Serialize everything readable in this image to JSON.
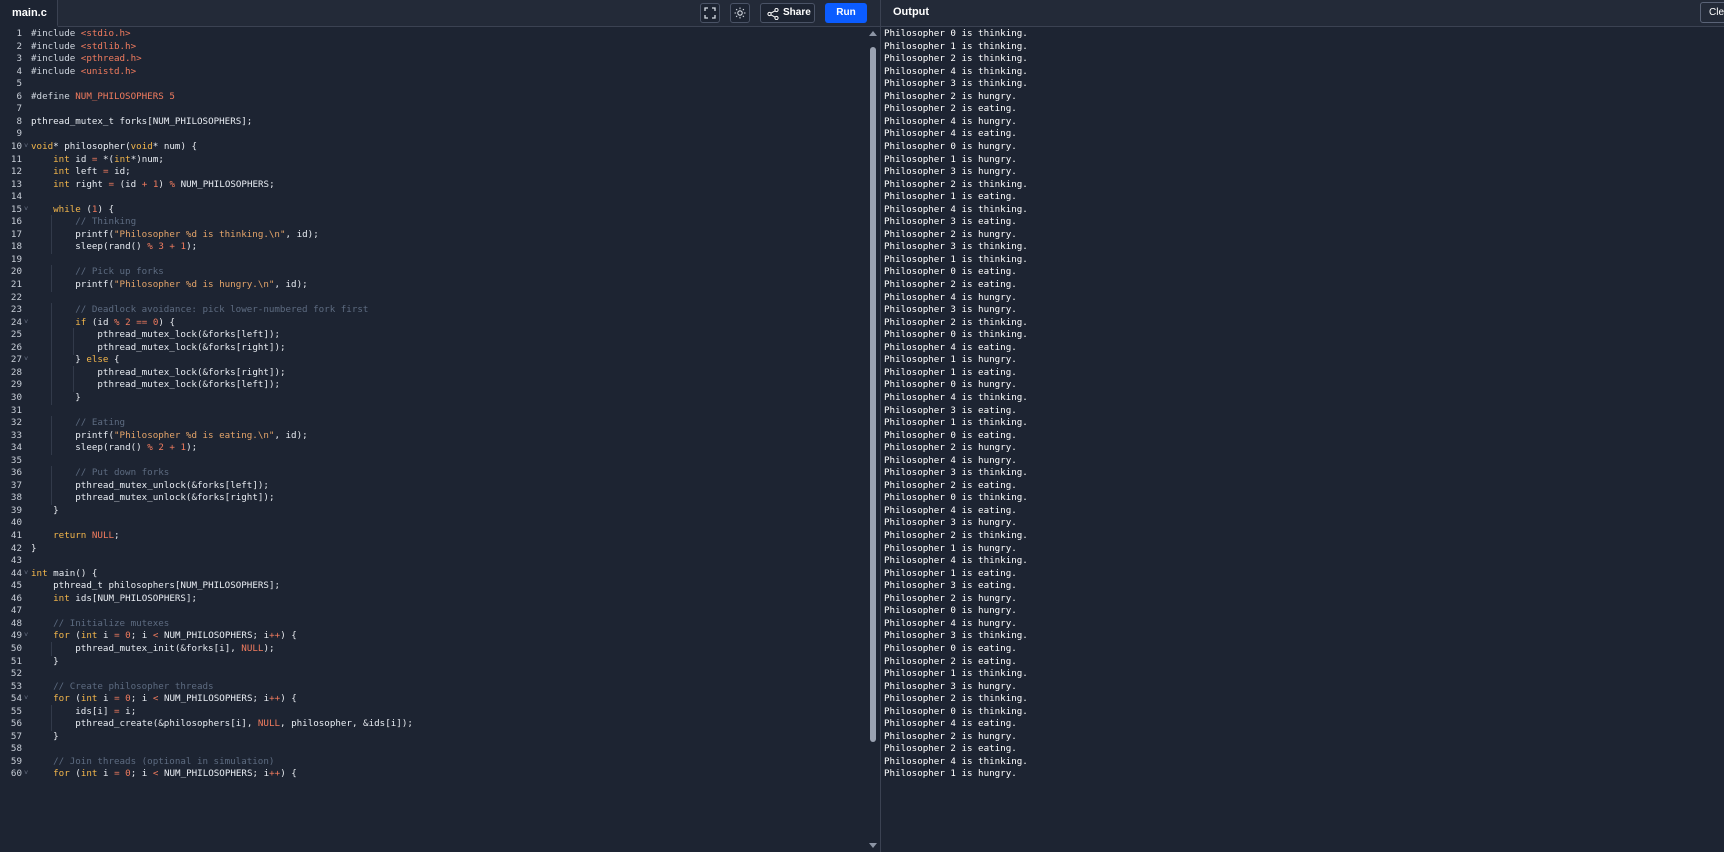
{
  "editor": {
    "file_tab": "main.c",
    "share_label": "Share",
    "run_label": "Run",
    "fullscreen_icon": "fullscreen-icon",
    "theme_icon": "sun-icon",
    "share_icon": "share-icon"
  },
  "output": {
    "title": "Output",
    "clear_label": "Clear"
  },
  "code_lines": [
    "#include <stdio.h>",
    "#include <stdlib.h>",
    "#include <pthread.h>",
    "#include <unistd.h>",
    "",
    "#define NUM_PHILOSOPHERS 5",
    "",
    "pthread_mutex_t forks[NUM_PHILOSOPHERS];",
    "",
    "void* philosopher(void* num) {",
    "    int id = *(int*)num;",
    "    int left = id;",
    "    int right = (id + 1) % NUM_PHILOSOPHERS;",
    "",
    "    while (1) {",
    "        // Thinking",
    "        printf(\"Philosopher %d is thinking.\\n\", id);",
    "        sleep(rand() % 3 + 1);",
    "",
    "        // Pick up forks",
    "        printf(\"Philosopher %d is hungry.\\n\", id);",
    "",
    "        // Deadlock avoidance: pick lower-numbered fork first",
    "        if (id % 2 == 0) {",
    "            pthread_mutex_lock(&forks[left]);",
    "            pthread_mutex_lock(&forks[right]);",
    "        } else {",
    "            pthread_mutex_lock(&forks[right]);",
    "            pthread_mutex_lock(&forks[left]);",
    "        }",
    "",
    "        // Eating",
    "        printf(\"Philosopher %d is eating.\\n\", id);",
    "        sleep(rand() % 2 + 1);",
    "",
    "        // Put down forks",
    "        pthread_mutex_unlock(&forks[left]);",
    "        pthread_mutex_unlock(&forks[right]);",
    "    }",
    "",
    "    return NULL;",
    "}",
    "",
    "int main() {",
    "    pthread_t philosophers[NUM_PHILOSOPHERS];",
    "    int ids[NUM_PHILOSOPHERS];",
    "",
    "    // Initialize mutexes",
    "    for (int i = 0; i < NUM_PHILOSOPHERS; i++) {",
    "        pthread_mutex_init(&forks[i], NULL);",
    "    }",
    "",
    "    // Create philosopher threads",
    "    for (int i = 0; i < NUM_PHILOSOPHERS; i++) {",
    "        ids[i] = i;",
    "        pthread_create(&philosophers[i], NULL, philosopher, &ids[i]);",
    "    }",
    "",
    "    // Join threads (optional in simulation)",
    "    for (int i = 0; i < NUM_PHILOSOPHERS; i++) {"
  ],
  "output_lines": [
    "Philosopher 0 is thinking.",
    "Philosopher 1 is thinking.",
    "Philosopher 2 is thinking.",
    "Philosopher 4 is thinking.",
    "Philosopher 3 is thinking.",
    "Philosopher 2 is hungry.",
    "Philosopher 2 is eating.",
    "Philosopher 4 is hungry.",
    "Philosopher 4 is eating.",
    "Philosopher 0 is hungry.",
    "Philosopher 1 is hungry.",
    "Philosopher 3 is hungry.",
    "Philosopher 2 is thinking.",
    "Philosopher 1 is eating.",
    "Philosopher 4 is thinking.",
    "Philosopher 3 is eating.",
    "Philosopher 2 is hungry.",
    "Philosopher 3 is thinking.",
    "Philosopher 1 is thinking.",
    "Philosopher 0 is eating.",
    "Philosopher 2 is eating.",
    "Philosopher 4 is hungry.",
    "Philosopher 3 is hungry.",
    "Philosopher 2 is thinking.",
    "Philosopher 0 is thinking.",
    "Philosopher 4 is eating.",
    "Philosopher 1 is hungry.",
    "Philosopher 1 is eating.",
    "Philosopher 0 is hungry.",
    "Philosopher 4 is thinking.",
    "Philosopher 3 is eating.",
    "Philosopher 1 is thinking.",
    "Philosopher 0 is eating.",
    "Philosopher 2 is hungry.",
    "Philosopher 4 is hungry.",
    "Philosopher 3 is thinking.",
    "Philosopher 2 is eating.",
    "Philosopher 0 is thinking.",
    "Philosopher 4 is eating.",
    "Philosopher 3 is hungry.",
    "Philosopher 2 is thinking.",
    "Philosopher 1 is hungry.",
    "Philosopher 4 is thinking.",
    "Philosopher 1 is eating.",
    "Philosopher 3 is eating.",
    "Philosopher 2 is hungry.",
    "Philosopher 0 is hungry.",
    "Philosopher 4 is hungry.",
    "Philosopher 3 is thinking.",
    "Philosopher 0 is eating.",
    "Philosopher 2 is eating.",
    "Philosopher 1 is thinking.",
    "Philosopher 3 is hungry.",
    "Philosopher 2 is thinking.",
    "Philosopher 0 is thinking.",
    "Philosopher 4 is eating.",
    "Philosopher 2 is hungry.",
    "Philosopher 2 is eating.",
    "Philosopher 4 is thinking.",
    "Philosopher 1 is hungry."
  ]
}
